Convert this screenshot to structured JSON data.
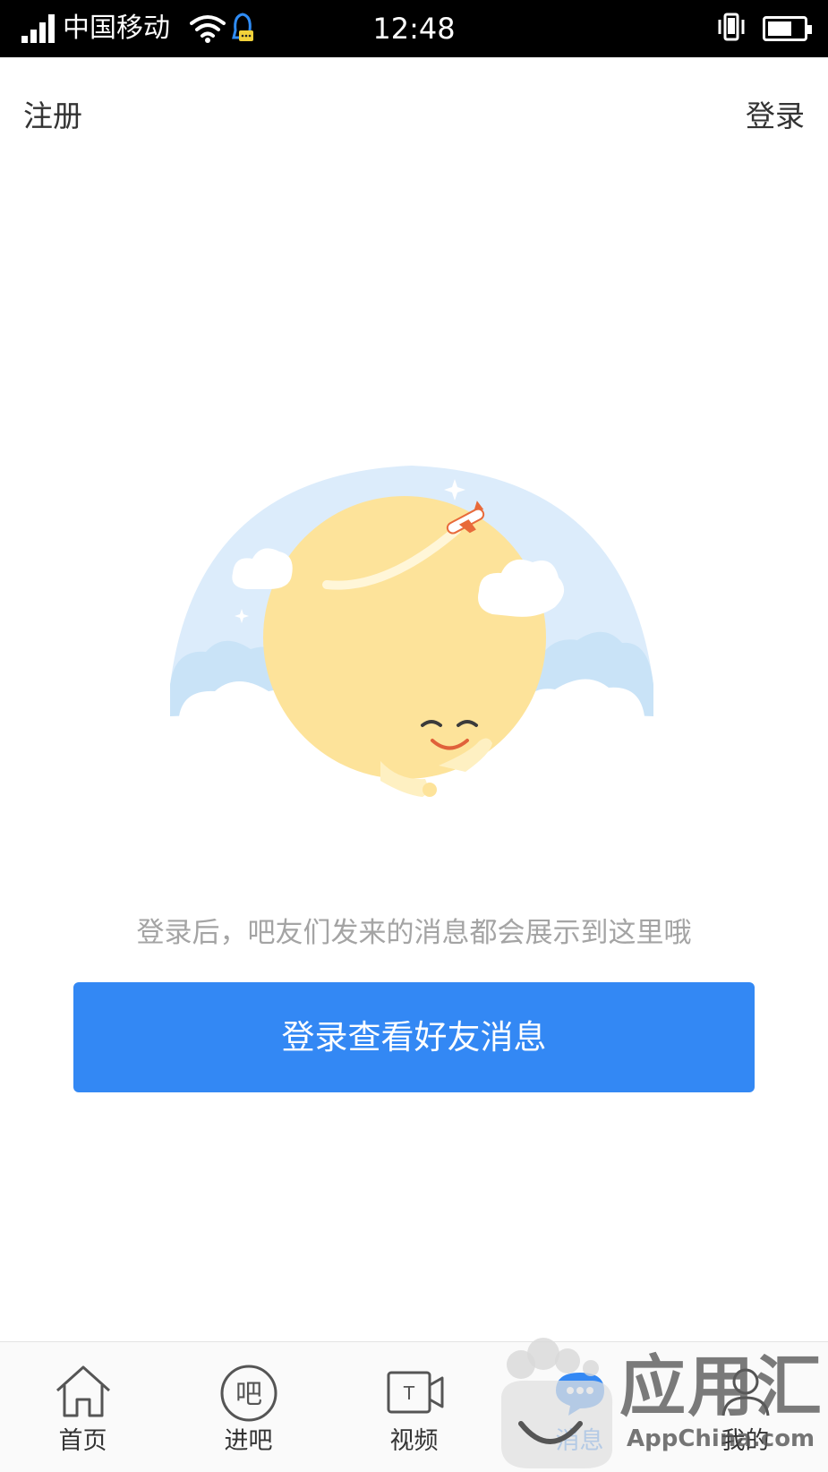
{
  "status_bar": {
    "carrier": "中国移动",
    "time": "12:48"
  },
  "header": {
    "register_label": "注册",
    "login_label": "登录"
  },
  "empty_state": {
    "message": "登录后，吧友们发来的消息都会展示到这里哦",
    "button_label": "登录查看好友消息"
  },
  "tab_bar": {
    "tabs": [
      {
        "label": "首页",
        "icon": "home-icon"
      },
      {
        "label": "进吧",
        "icon": "enter-bar-icon",
        "icon_text": "吧"
      },
      {
        "label": "视频",
        "icon": "video-icon",
        "icon_text": "T"
      },
      {
        "label": "消息",
        "icon": "message-icon",
        "active": true
      },
      {
        "label": "我的",
        "icon": "profile-icon"
      }
    ]
  },
  "watermark": {
    "title": "应用汇",
    "subtitle": "AppChina.com"
  },
  "colors": {
    "accent": "#3388f4",
    "status_bar_bg": "#000000",
    "hint_text": "#a4a4a4",
    "sun": "#fde39a",
    "sky": "#dcecfb"
  }
}
